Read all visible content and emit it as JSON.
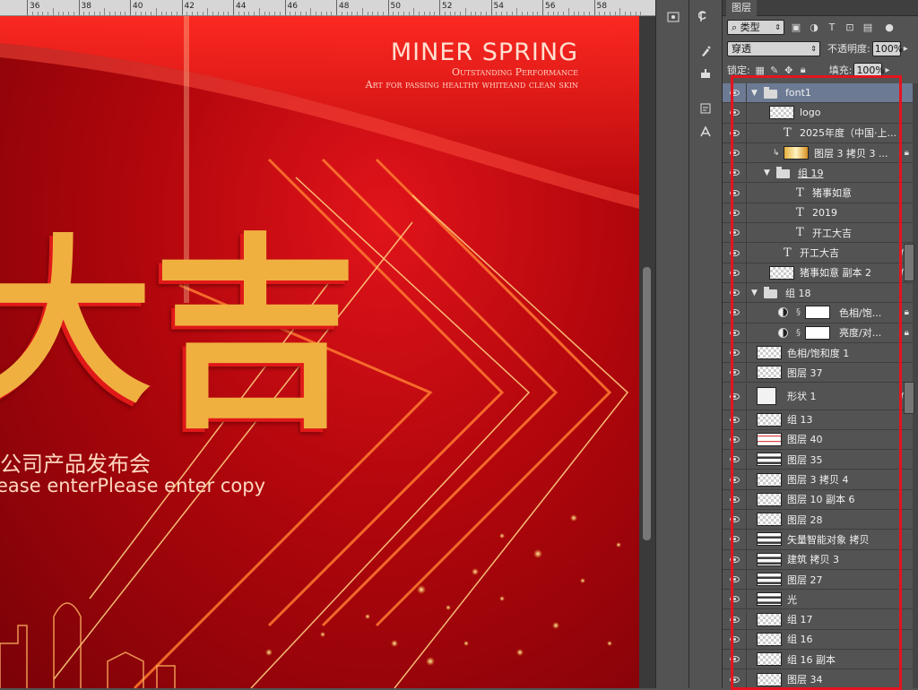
{
  "rulers": {
    "top_numbers": [
      "36",
      "38",
      "40",
      "42",
      "44",
      "46",
      "48",
      "50",
      "52",
      "54",
      "56",
      "58"
    ]
  },
  "poster": {
    "title": "MINER SPRING",
    "subtitle_line1": "Outstanding Performance",
    "subtitle_line2": "Art for passing healthy whiteand clean skin",
    "big_chars": [
      "大",
      "吉"
    ],
    "cn_subtitle": "公司产品发布会",
    "en_subtitle": "ease enterPlease enter copy"
  },
  "panel": {
    "tab_label": "图层",
    "filter_label": "类型",
    "blend_mode": "穿透",
    "opacity_label": "不透明度:",
    "opacity_value": "100%",
    "lock_label": "锁定:",
    "fill_label": "填充:",
    "fill_value": "100%"
  },
  "layers": [
    {
      "name": "font1",
      "kind": "group",
      "expanded": true,
      "indent": 0,
      "selected": true
    },
    {
      "name": "logo",
      "kind": "pixel",
      "indent": 1
    },
    {
      "name": "2025年度（中国·上...",
      "kind": "text",
      "indent": 1
    },
    {
      "name": "图层 3 拷贝 3 ...",
      "kind": "pixel-gold",
      "indent": 1,
      "clipped": true,
      "locked": true
    },
    {
      "name": "组 19",
      "kind": "group",
      "expanded": true,
      "indent": 1
    },
    {
      "name": "猪事如意",
      "kind": "text",
      "indent": 2
    },
    {
      "name": "2019",
      "kind": "text",
      "indent": 2
    },
    {
      "name": "开工大吉",
      "kind": "text",
      "indent": 2
    },
    {
      "name": "开工大吉",
      "kind": "text",
      "indent": 1,
      "fx": true
    },
    {
      "name": "猪事如意 副本 2",
      "kind": "pixel",
      "indent": 1,
      "fx": true
    },
    {
      "name": "组 18",
      "kind": "group",
      "expanded": true,
      "indent": 0
    },
    {
      "name": "色相/饱...",
      "kind": "adjustment",
      "indent": 1,
      "locked": true
    },
    {
      "name": "亮度/对...",
      "kind": "adjustment",
      "indent": 1,
      "locked": true
    },
    {
      "name": "色相/饱和度 1",
      "kind": "pixel",
      "indent": 0
    },
    {
      "name": "图层 37",
      "kind": "pixel",
      "indent": 0
    },
    {
      "name": "形状 1",
      "kind": "shape",
      "indent": 0,
      "fx": true,
      "tall": true
    },
    {
      "name": "组 13",
      "kind": "pixel",
      "indent": 0
    },
    {
      "name": "图层 40",
      "kind": "pixel-red",
      "indent": 0
    },
    {
      "name": "图层 35",
      "kind": "pixel-dark",
      "indent": 0
    },
    {
      "name": "图层 3 拷贝 4",
      "kind": "pixel",
      "indent": 0
    },
    {
      "name": "图层 10 副本 6",
      "kind": "pixel",
      "indent": 0
    },
    {
      "name": "图层 28",
      "kind": "pixel",
      "indent": 0
    },
    {
      "name": "矢量智能对象 拷贝",
      "kind": "pixel-dark",
      "indent": 0
    },
    {
      "name": "建筑 拷贝 3",
      "kind": "pixel-dark",
      "indent": 0
    },
    {
      "name": "图层 27",
      "kind": "pixel-dark",
      "indent": 0
    },
    {
      "name": "光",
      "kind": "pixel-dark",
      "indent": 0
    },
    {
      "name": "组 17",
      "kind": "pixel",
      "indent": 0
    },
    {
      "name": "组 16",
      "kind": "pixel",
      "indent": 0
    },
    {
      "name": "组 16 副本",
      "kind": "pixel",
      "indent": 0
    },
    {
      "name": "图层 34",
      "kind": "pixel",
      "indent": 0
    }
  ],
  "colors": {
    "panel_bg": "#535353",
    "selected_row": "#6c7a93",
    "highlight_box": "#e4141e",
    "poster_red": "#c8080e",
    "gold": "#f0b040"
  }
}
